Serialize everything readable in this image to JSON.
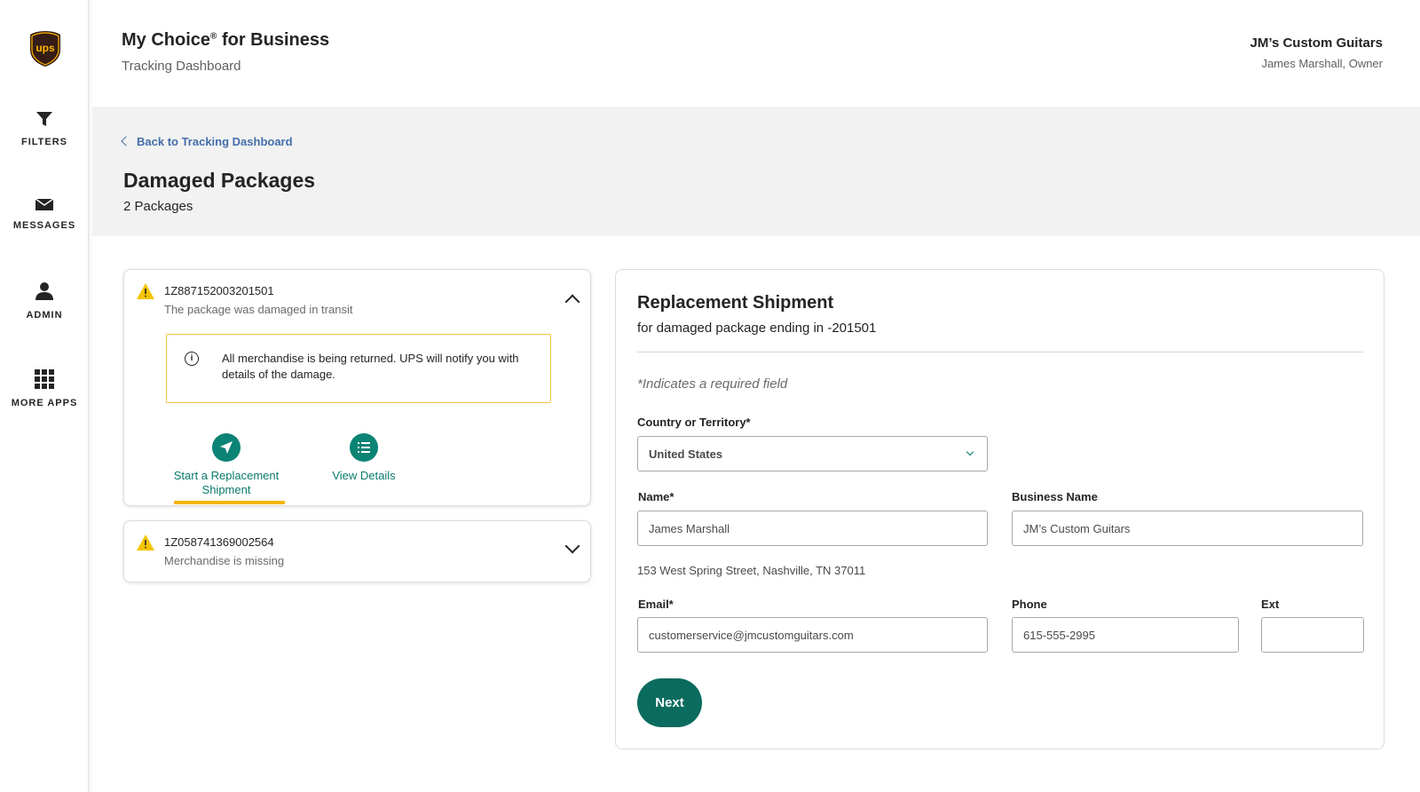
{
  "brand": {
    "logo_text": "ups",
    "logo_color": "#351c15",
    "logo_accent": "#ffb500"
  },
  "sidebar": {
    "items": [
      {
        "label": "FILTERS",
        "icon": "filter-icon"
      },
      {
        "label": "MESSAGES",
        "icon": "envelope-icon"
      },
      {
        "label": "ADMIN",
        "icon": "person-icon"
      },
      {
        "label": "MORE APPS",
        "icon": "grid-icon"
      }
    ]
  },
  "header": {
    "title_main": "My Choice",
    "title_reg": "®",
    "title_suffix": " for Business",
    "subtitle": "Tracking Dashboard",
    "company": "JM’s Custom Guitars",
    "user": "James Marshall, Owner"
  },
  "page": {
    "back_link": "Back to Tracking Dashboard",
    "title": "Damaged Packages",
    "count": "2 Packages"
  },
  "packages": [
    {
      "tracking": "1Z887152003201501",
      "status": "The package was damaged in transit",
      "expanded": true,
      "info": "All merchandise is being returned. UPS will notify you with details of the damage.",
      "actions": [
        {
          "label": "Start a Replacement Shipment",
          "icon": "airplane-icon"
        },
        {
          "label": "View Details",
          "icon": "list-icon"
        }
      ]
    },
    {
      "tracking": "1Z058741369002564",
      "status": "Merchandise is missing",
      "expanded": false
    }
  ],
  "form": {
    "title": "Replacement Shipment",
    "subtitle": "for damaged package ending in -201501",
    "required_note": "*Indicates a required field",
    "country_label": "Country or Territory*",
    "country_value": "United States",
    "name_label": "Name*",
    "name_value": "James Marshall",
    "business_label": "Business Name",
    "business_value": "JM’s Custom Guitars",
    "address": "153 West Spring Street, Nashville, TN 37011",
    "email_label": "Email*",
    "email_value": "customerservice@jmcustomguitars.com",
    "phone_label": "Phone",
    "phone_value": "615-555-2995",
    "ext_label": "Ext",
    "ext_value": "",
    "next_label": "Next"
  },
  "colors": {
    "accent_teal": "#0b8375",
    "warning_yellow": "#f5b400",
    "link_blue": "#426da9"
  }
}
